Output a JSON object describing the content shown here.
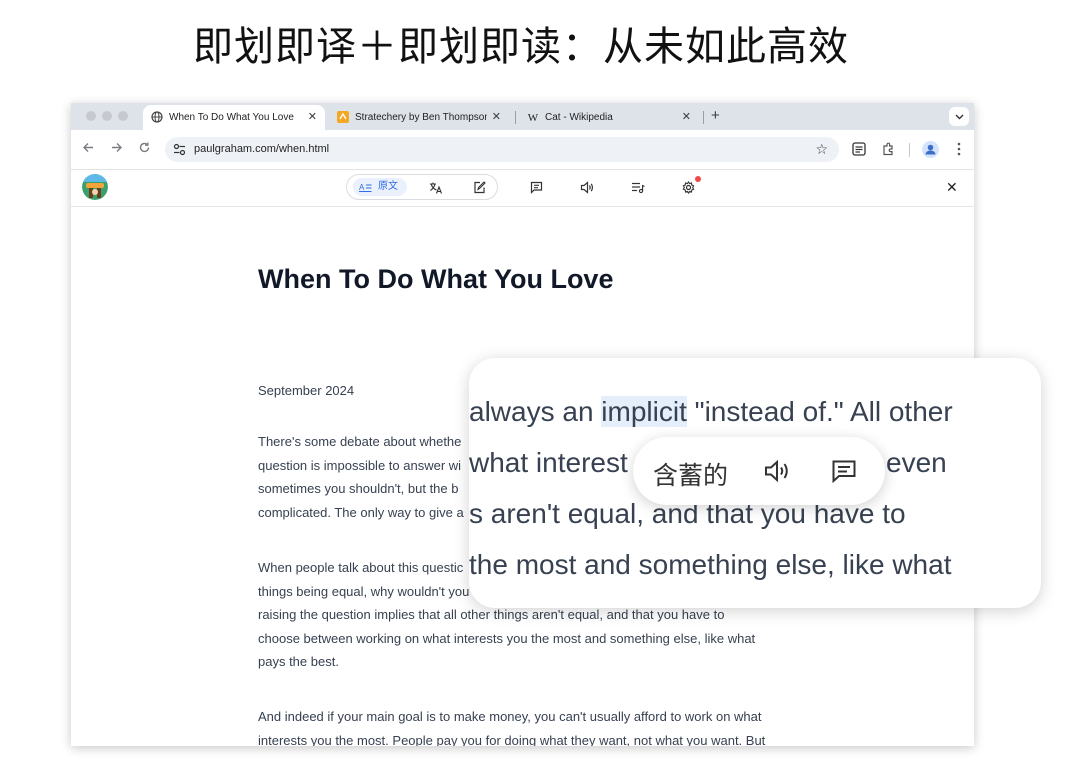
{
  "headline": "即划即译＋即划即读：从未如此高效",
  "tabs": [
    {
      "title": "When To Do What You Love",
      "icon": "globe-icon",
      "active": true
    },
    {
      "title": "Stratechery by Ben Thompson",
      "icon": "stratechery-favicon",
      "active": false
    },
    {
      "title": "Cat - Wikipedia",
      "icon": "wikipedia-favicon",
      "active": false
    }
  ],
  "tab_close": "✕",
  "new_tab": "+",
  "address": {
    "url": "paulgraham.com/when.html"
  },
  "reader_toolbar": {
    "original_label": "原文"
  },
  "article": {
    "title": "When To Do What You Love",
    "date": "September 2024",
    "para1": [
      "There's some debate about whethe",
      "question is impossible to answer wi",
      "sometimes you shouldn't, but the b",
      "complicated. The only way to give a"
    ],
    "para2": [
      "When people talk about this questic",
      "things being equal, why wouldn't you",
      "raising the question implies that all other things aren't equal, and that you have to",
      "choose between working on what interests you the most and something else, like what",
      "pays the best."
    ],
    "para3": [
      "And indeed if your main goal is to make money, you can't usually afford to work on what",
      "interests you the most. People pay you for doing what they want, not what you want. But"
    ]
  },
  "zoom": {
    "line1_pre": "always an ",
    "line1_highlight": "implicit",
    "line1_post": " \"instead of.\" All other",
    "line2_left": "what interest",
    "line2_right": "even",
    "line3": "s aren't equal, and that you have to",
    "line4": " the most and something else, like what",
    "tooltip_translation": "含蓄的"
  }
}
